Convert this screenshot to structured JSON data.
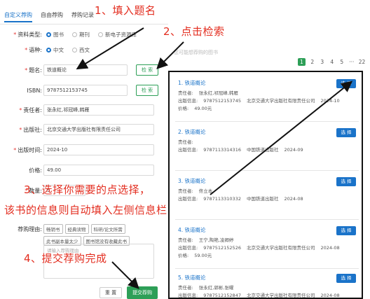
{
  "tabs": [
    "自定义荐购",
    "自由荐购",
    "荐购记录"
  ],
  "form": {
    "resource_type": {
      "label": "资料类型:",
      "options": [
        "图书",
        "期刊",
        "新电子资源库"
      ]
    },
    "language": {
      "label": "语种:",
      "options": [
        "中文",
        "西文"
      ]
    },
    "title": {
      "label": "题名:",
      "value": "铁道概论",
      "button": "检 索"
    },
    "isbn": {
      "label": "ISBN:",
      "value": "9787512153745",
      "button": "检 索"
    },
    "author": {
      "label": "责任者:",
      "value": "张永红,祁冠峰,韩雁"
    },
    "publisher": {
      "label": "出版社:",
      "value": "北京交通大学出版社有限责任公司"
    },
    "pub_date": {
      "label": "出版时间:",
      "value": "2024-10"
    },
    "price": {
      "label": "价格:",
      "value": "49.00"
    },
    "quantity": {
      "label": "数量:",
      "value": "5"
    },
    "reason": {
      "label": "荐购理由:",
      "tags": [
        "畅销书",
        "经典读物",
        "科研/论文所需",
        "此书副本量太少",
        "图书馆没有收藏此书"
      ],
      "placeholder": "请输入荐购理由"
    }
  },
  "buttons": {
    "reset": "重 置",
    "submit": "提交荐购"
  },
  "results": {
    "hint": "您可能想荐购的图书",
    "pager": [
      "1",
      "2",
      "3",
      "4",
      "5",
      "···",
      "22",
      "›"
    ],
    "select_label": "选 择",
    "author_label": "责任者:",
    "publish_label": "出版信息:",
    "price_label": "价格:",
    "items": [
      {
        "title": "1. 铁道概论",
        "author": "张永红,祁冠峰,韩雁",
        "isbn": "9787512153745",
        "publisher": "北京交通大学出版社有限责任公司",
        "date": "2024-10",
        "price": "49.00元"
      },
      {
        "title": "2. 铁道概论",
        "author": "",
        "isbn": "9787113314316",
        "publisher": "中国铁道出版社",
        "date": "2024-09",
        "price": ""
      },
      {
        "title": "3. 铁道概论",
        "author": "佟立本",
        "isbn": "9787113310332",
        "publisher": "中国铁道出版社",
        "date": "2024-08",
        "price": ""
      },
      {
        "title": "4. 铁道概论",
        "author": "王宁,陶艳,凌卿婷",
        "isbn": "9787512152526",
        "publisher": "北京交通大学出版社有限责任公司",
        "date": "2024-08",
        "price": "59.00元"
      },
      {
        "title": "5. 铁道概论",
        "author": "张永红,郭彬,张曜",
        "isbn": "9787512152847",
        "publisher": "北京交通大学出版社有限责任公司",
        "date": "2024-08",
        "price": ""
      }
    ]
  },
  "annotations": {
    "step1": "1、填入题名",
    "step2": "2、点击检索",
    "step3a": "3、选择你需要的点选择，",
    "step3b": "该书的信息则自动填入左侧信息栏",
    "step4": "4、提交荐购完成"
  },
  "colors": {
    "accent_blue": "#1a73c9",
    "accent_green": "#2d9f57",
    "annotation_red": "#e32d1f"
  }
}
